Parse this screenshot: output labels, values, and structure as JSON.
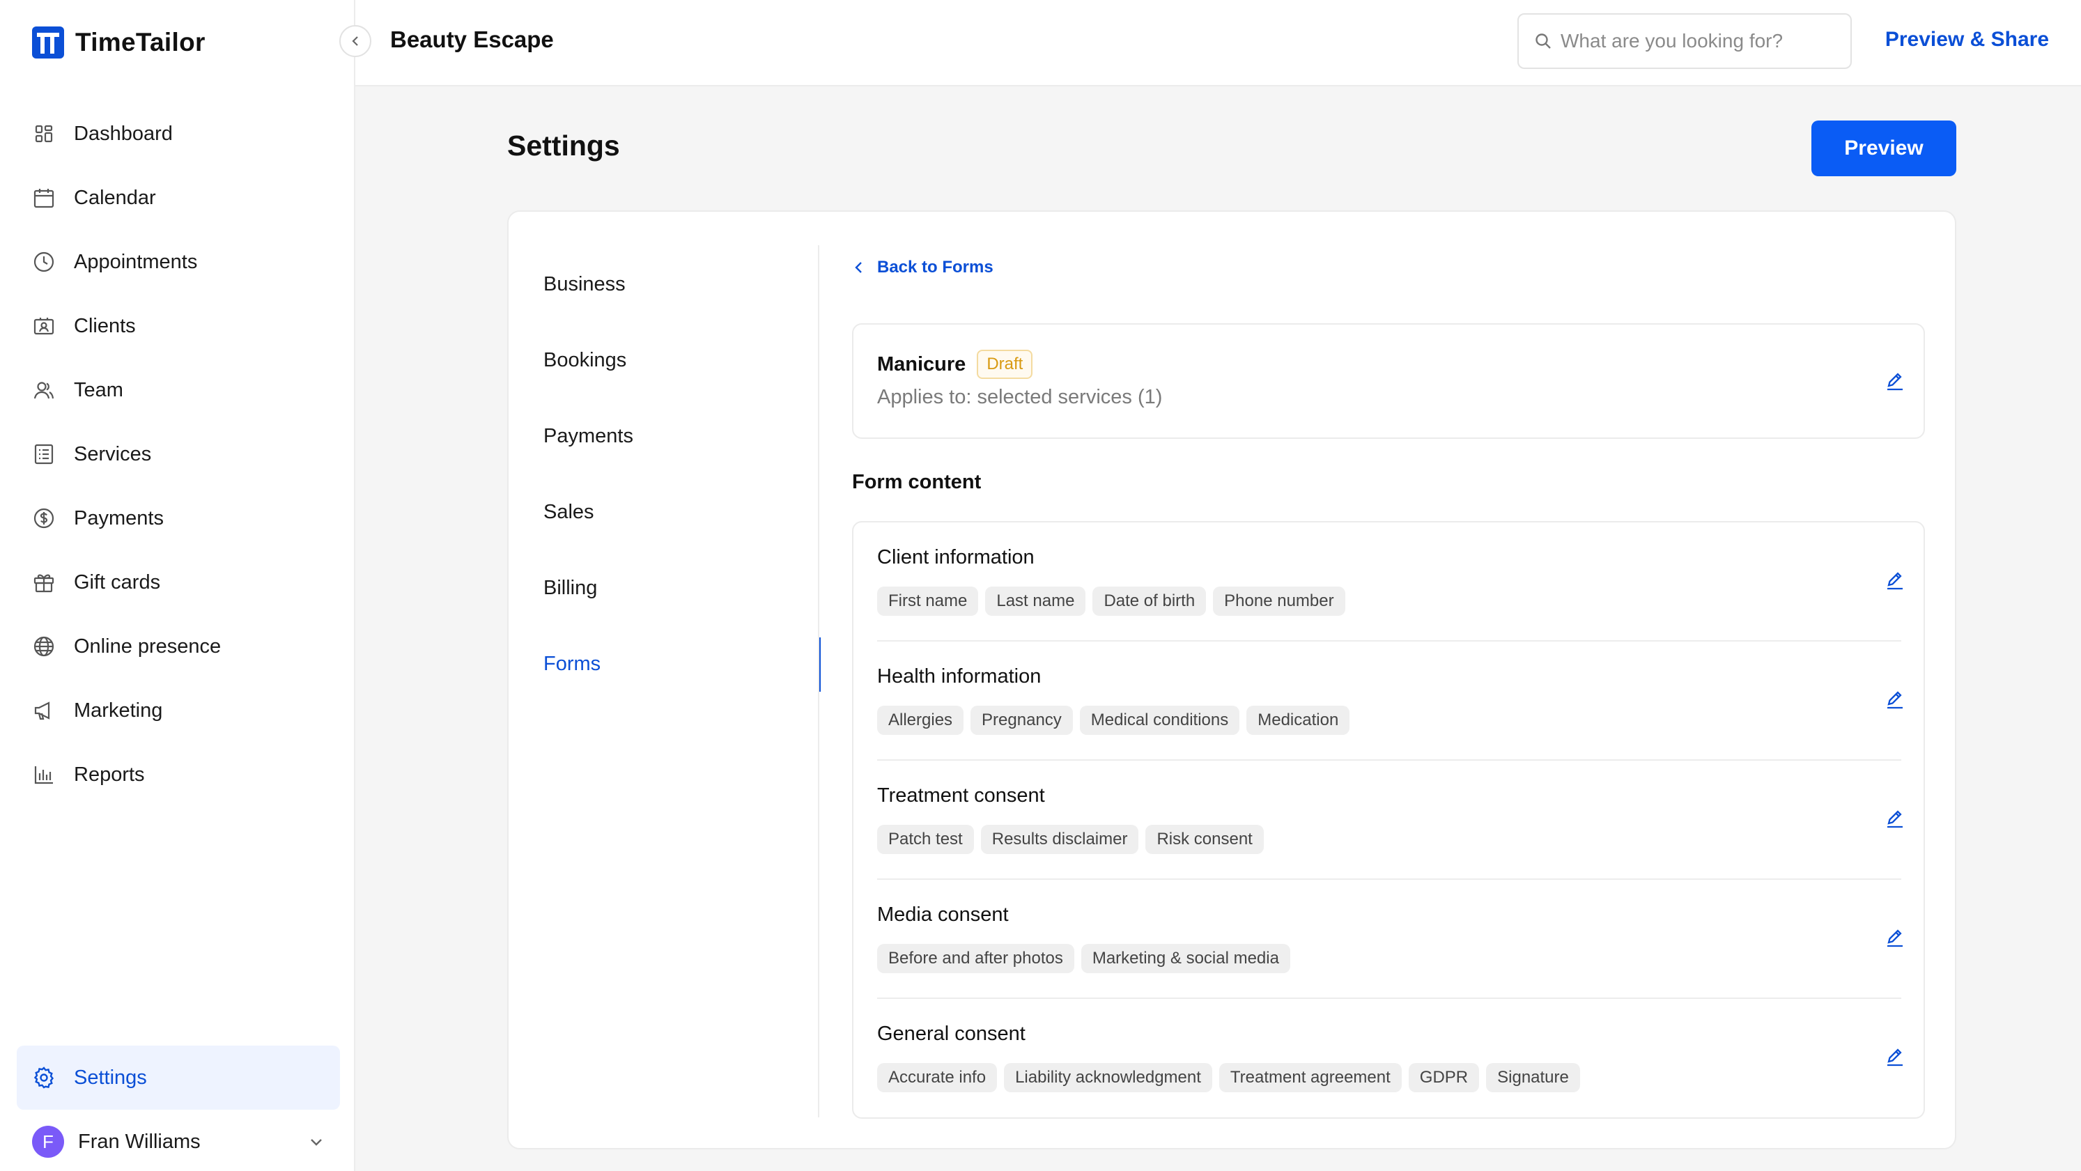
{
  "brand": {
    "name": "TimeTailor"
  },
  "sidebar": {
    "items": [
      {
        "label": "Dashboard",
        "icon": "grid-icon"
      },
      {
        "label": "Calendar",
        "icon": "calendar-icon"
      },
      {
        "label": "Appointments",
        "icon": "clock-icon"
      },
      {
        "label": "Clients",
        "icon": "contact-card-icon"
      },
      {
        "label": "Team",
        "icon": "people-icon"
      },
      {
        "label": "Services",
        "icon": "list-icon"
      },
      {
        "label": "Payments",
        "icon": "dollar-icon"
      },
      {
        "label": "Gift cards",
        "icon": "gift-icon"
      },
      {
        "label": "Online presence",
        "icon": "globe-icon"
      },
      {
        "label": "Marketing",
        "icon": "megaphone-icon"
      },
      {
        "label": "Reports",
        "icon": "bar-chart-icon"
      }
    ],
    "settings_label": "Settings",
    "user": {
      "initial": "F",
      "name": "Fran Williams"
    }
  },
  "topbar": {
    "business_name": "Beauty Escape",
    "search_placeholder": "What are you looking for?",
    "preview_share_label": "Preview & Share"
  },
  "page": {
    "title": "Settings",
    "preview_label": "Preview"
  },
  "subnav": {
    "items": [
      "Business",
      "Bookings",
      "Payments",
      "Sales",
      "Billing",
      "Forms"
    ],
    "active": "Forms"
  },
  "form": {
    "back_label": "Back to Forms",
    "name": "Manicure",
    "status": "Draft",
    "applies_to": "Applies to: selected services (1)",
    "content_heading": "Form content",
    "sections": [
      {
        "title": "Client information",
        "chips": [
          "First name",
          "Last name",
          "Date of birth",
          "Phone number"
        ]
      },
      {
        "title": "Health information",
        "chips": [
          "Allergies",
          "Pregnancy",
          "Medical conditions",
          "Medication"
        ]
      },
      {
        "title": "Treatment consent",
        "chips": [
          "Patch test",
          "Results disclaimer",
          "Risk consent"
        ]
      },
      {
        "title": "Media consent",
        "chips": [
          "Before and after photos",
          "Marketing & social media"
        ]
      },
      {
        "title": "General consent",
        "chips": [
          "Accurate info",
          "Liability acknowledgment",
          "Treatment agreement",
          "GDPR",
          "Signature"
        ]
      }
    ]
  },
  "colors": {
    "accent": "#0b4fd6",
    "primary_button": "#0a5cf5",
    "draft": "#d89a12",
    "avatar": "#7a5af8"
  }
}
